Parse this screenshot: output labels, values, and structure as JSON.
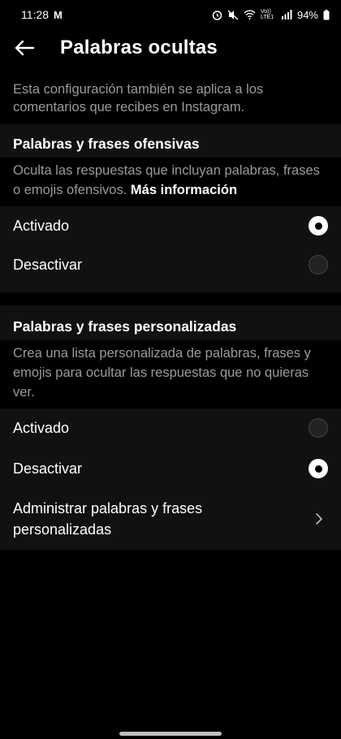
{
  "status_bar": {
    "time": "11:28",
    "carrier_badge": "M",
    "volte": "Vo)) LTE1",
    "battery": "94%",
    "icons": [
      "alarm-icon",
      "mute-icon",
      "wifi-icon",
      "signal-icon",
      "battery-icon"
    ]
  },
  "header": {
    "title": "Palabras ocultas",
    "back_icon": "arrow-left-icon"
  },
  "intro": "Esta configuración también se aplica a los comentarios que recibes en Instagram.",
  "offensive": {
    "title": "Palabras y frases ofensivas",
    "description": "Oculta las respuestas que incluyan palabras, frases o emojis ofensivos.",
    "more_link": "Más información",
    "options": [
      {
        "label": "Activado",
        "selected": true
      },
      {
        "label": "Desactivar",
        "selected": false
      }
    ]
  },
  "custom": {
    "title": "Palabras y frases personalizadas",
    "description": "Crea una lista personalizada de palabras, frases y emojis para ocultar las respuestas que no quieras ver.",
    "options": [
      {
        "label": "Activado",
        "selected": false
      },
      {
        "label": "Desactivar",
        "selected": true
      }
    ],
    "manage_label": "Administrar palabras y frases personalizadas"
  },
  "colors": {
    "background": "#000000",
    "panel": "#111111",
    "secondary_text": "#9a9a9a",
    "radio_on": "#ffffff",
    "radio_off": "#222222"
  }
}
